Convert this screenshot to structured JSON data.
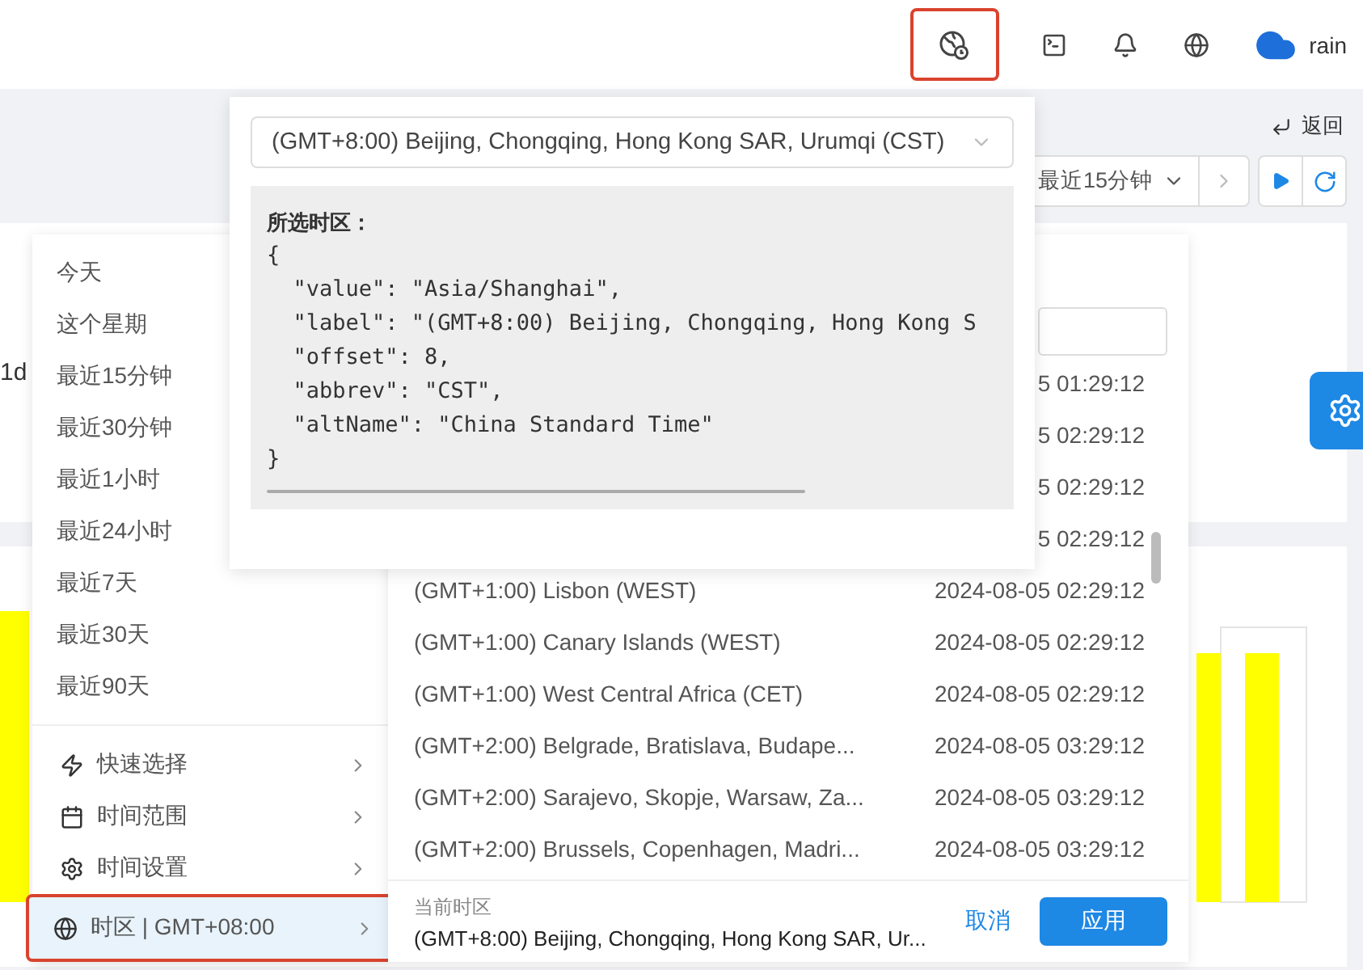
{
  "header": {
    "icons": [
      {
        "kind": "globe-clock",
        "highlighted": true
      },
      {
        "kind": "terminal",
        "highlighted": false
      },
      {
        "kind": "bell",
        "highlighted": false
      },
      {
        "kind": "globe",
        "highlighted": false
      }
    ],
    "user": "rain"
  },
  "back_link": "返回",
  "toolbar": {
    "range": "最近15分钟"
  },
  "background": {
    "card_label": "1d"
  },
  "menu": {
    "presets": [
      "今天",
      "这个星期",
      "最近15分钟",
      "最近30分钟",
      "最近1小时",
      "最近24小时",
      "最近7天",
      "最近30天",
      "最近90天"
    ],
    "sections": [
      {
        "kind": "quick",
        "label": "快速选择",
        "selected": false
      },
      {
        "kind": "range",
        "label": "时间范围",
        "selected": false
      },
      {
        "kind": "settings",
        "label": "时间设置",
        "selected": false
      },
      {
        "kind": "timezone",
        "label": "时区 | GMT+08:00",
        "selected": true
      }
    ]
  },
  "timezone_list": {
    "rows": [
      {
        "time": "5 01:29:12"
      },
      {
        "time": "5 02:29:12"
      },
      {
        "time": "5 02:29:12"
      },
      {
        "time": "5 02:29:12"
      },
      {
        "name": "(GMT+1:00) Lisbon (WEST)",
        "time": "2024-08-05 02:29:12"
      },
      {
        "name": "(GMT+1:00) Canary Islands (WEST)",
        "time": "2024-08-05 02:29:12"
      },
      {
        "name": "(GMT+1:00) West Central Africa (CET)",
        "time": "2024-08-05 02:29:12"
      },
      {
        "name": "(GMT+2:00) Belgrade, Bratislava, Budape...",
        "time": "2024-08-05 03:29:12"
      },
      {
        "name": "(GMT+2:00) Sarajevo, Skopje, Warsaw, Za...",
        "time": "2024-08-05 03:29:12"
      },
      {
        "name": "(GMT+2:00) Brussels, Copenhagen, Madri...",
        "time": "2024-08-05 03:29:12"
      }
    ],
    "footer": {
      "caption": "当前时区",
      "current": "(GMT+8:00) Beijing, Chongqing, Hong Kong SAR, Ur...",
      "cancel": "取消",
      "apply": "应用"
    }
  },
  "timezone_popover": {
    "select_value": "(GMT+8:00) Beijing, Chongqing, Hong Kong SAR, Urumqi (CST)",
    "code_title": "所选时区：",
    "code_lines": [
      "{",
      "  \"value\": \"Asia/Shanghai\",",
      "  \"label\": \"(GMT+8:00) Beijing, Chongqing, Hong Kong S",
      "  \"offset\": 8,",
      "  \"abbrev\": \"CST\",",
      "  \"altName\": \"China Standard Time\"",
      "}"
    ]
  }
}
